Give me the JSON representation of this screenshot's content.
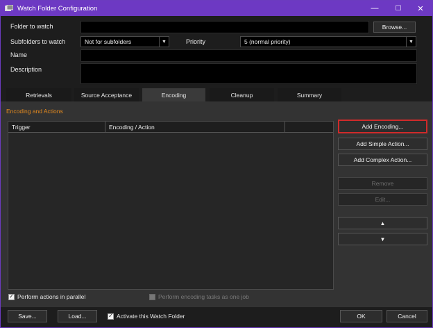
{
  "window": {
    "title": "Watch Folder Configuration",
    "minimize": "—",
    "maximize": "☐",
    "close": "✕",
    "accent": "#6d39c3"
  },
  "form": {
    "folder_label": "Folder to watch",
    "folder_value": "",
    "browse_label": "Browse...",
    "subfolders_label": "Subfolders to watch",
    "subfolders_value": "Not for subfolders",
    "priority_label": "Priority",
    "priority_value": "5 (normal priority)",
    "name_label": "Name",
    "name_value": "",
    "description_label": "Description",
    "description_value": ""
  },
  "tabs": [
    {
      "label": "Retrievals",
      "active": false
    },
    {
      "label": "Source Acceptance",
      "active": false
    },
    {
      "label": "Encoding",
      "active": true
    },
    {
      "label": "Cleanup",
      "active": false
    },
    {
      "label": "Summary",
      "active": false
    }
  ],
  "encoding": {
    "section_title": "Encoding and Actions",
    "section_color": "#e48a1f",
    "columns": [
      "Trigger",
      "Encoding / Action",
      ""
    ],
    "rows": [],
    "buttons": {
      "add_encoding": "Add Encoding...",
      "add_simple_action": "Add Simple Action...",
      "add_complex_action": "Add Complex Action...",
      "remove": "Remove",
      "edit": "Edit...",
      "up": "▲",
      "down": "▼"
    },
    "parallel_label": "Perform actions in parallel",
    "parallel_checked": true,
    "one_job_label": "Perform encoding tasks as one job",
    "one_job_checked": false
  },
  "footer": {
    "save_label": "Save...",
    "load_label": "Load...",
    "activate_label": "Activate this Watch Folder",
    "activate_checked": true,
    "ok_label": "OK",
    "cancel_label": "Cancel"
  }
}
